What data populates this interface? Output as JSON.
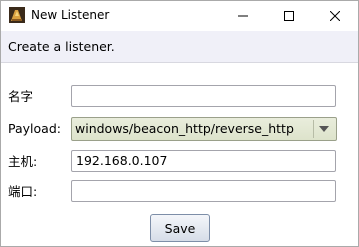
{
  "window": {
    "title": "New Listener",
    "icon": "cobalt-strike-app-icon",
    "controls": {
      "minimize_icon": "minimize-icon",
      "maximize_icon": "maximize-icon",
      "close_icon": "close-icon"
    }
  },
  "banner": {
    "text": "Create a listener."
  },
  "form": {
    "name": {
      "label": "名字",
      "value": ""
    },
    "payload": {
      "label": "Payload:",
      "selected": "windows/beacon_http/reverse_http",
      "arrow_icon": "chevron-down-icon"
    },
    "host": {
      "label": "主机:",
      "value": "192.168.0.107"
    },
    "port": {
      "label": "端口:",
      "value": ""
    }
  },
  "actions": {
    "save_label": "Save"
  },
  "colors": {
    "banner_bg": "#f0f0f8",
    "select_bg": "#e3e8d3",
    "button_border": "#7d8ea8"
  }
}
